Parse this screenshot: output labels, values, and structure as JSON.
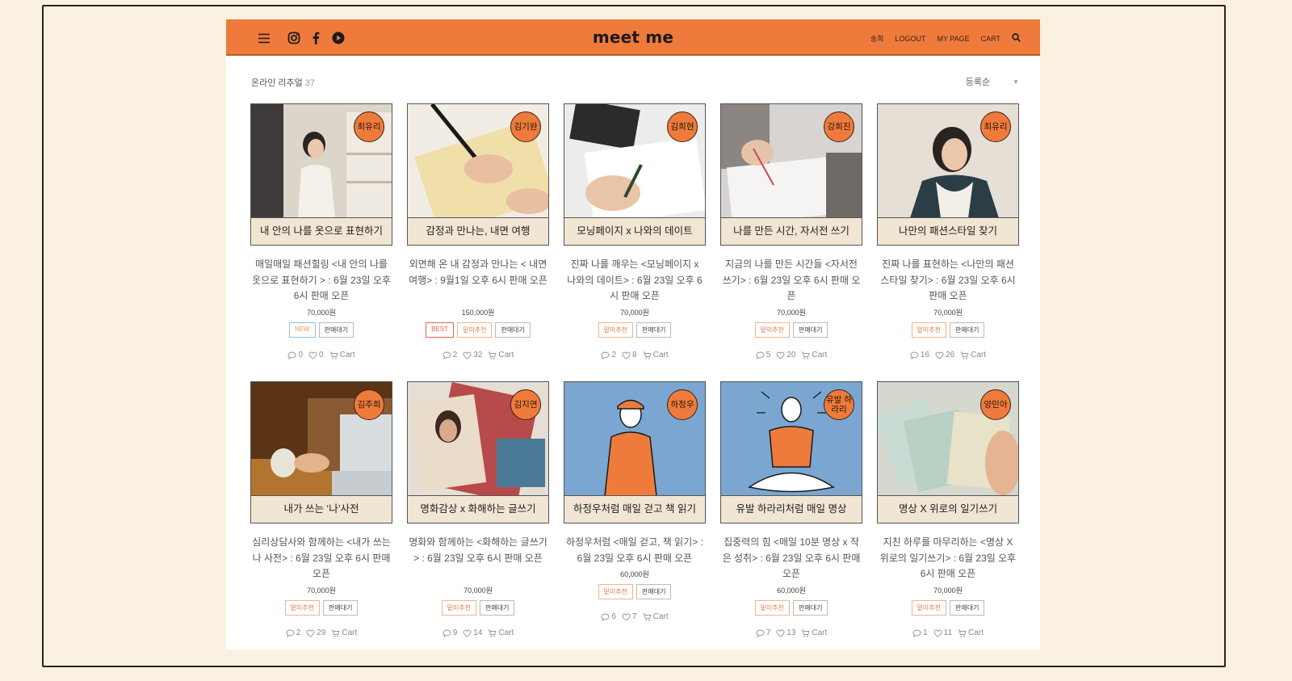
{
  "header": {
    "brand": "meet me",
    "nav": [
      "송희",
      "LOGOUT",
      "MY PAGE",
      "CART"
    ],
    "icons": [
      "menu-icon",
      "instagram-icon",
      "facebook-icon",
      "youtube-icon",
      "search-icon"
    ],
    "accent": "#ee7b3c"
  },
  "toolbar": {
    "category": "온라인 리추얼",
    "count": "37",
    "sort": "등록순"
  },
  "products": [
    {
      "host": "최유리",
      "caption": "내 안의 나를 옷으로 표현하기",
      "title": "매일매일 패션힐링 <내 안의 나를 옷으로 표현하기 > : 6월 23일 오후 6시 판매 오픈",
      "price": "70,000원",
      "tags": [
        {
          "t": "NEW",
          "k": "new"
        },
        {
          "t": "판매대기",
          "k": ""
        }
      ],
      "comments": "0",
      "likes": "0",
      "cart": "Cart",
      "photo": "#d9d3c8"
    },
    {
      "host": "김기완",
      "caption": "감정과 만나는, 내면 여행",
      "title": "외면해 온 내 감정과 만나는 < 내면 여행> : 9월1일 오후 6시 판매 오픈",
      "price": "150,000원",
      "tags": [
        {
          "t": "BEST",
          "k": "best"
        },
        {
          "t": "밑미추천",
          "k": "rec"
        },
        {
          "t": "판매대기",
          "k": ""
        }
      ],
      "comments": "2",
      "likes": "32",
      "cart": "Cart",
      "photo": "#e6dac0"
    },
    {
      "host": "김희현",
      "caption": "모닝페이지 x 나와의 데이트",
      "title": "진짜 나를 깨우는 <모닝페이지 x 나와의 데이트> : 6월 23일 오후 6시 판매 오픈",
      "price": "70,000원",
      "tags": [
        {
          "t": "밑미추천",
          "k": "rec"
        },
        {
          "t": "판매대기",
          "k": ""
        }
      ],
      "comments": "2",
      "likes": "8",
      "cart": "Cart",
      "photo": "#e9e7e2"
    },
    {
      "host": "강희진",
      "caption": "나를 만든 시간, 자서전 쓰기",
      "title": "지금의 나를 만든 시간들 <자서전 쓰기> : 6월 23일 오후 6시 판매 오픈",
      "price": "70,000원",
      "tags": [
        {
          "t": "밑미추천",
          "k": "rec"
        },
        {
          "t": "판매대기",
          "k": ""
        }
      ],
      "comments": "5",
      "likes": "20",
      "cart": "Cart",
      "photo": "#d8d4d0"
    },
    {
      "host": "최유리",
      "caption": "나만의 패션스타일 찾기",
      "title": "진짜 나를 표현하는 <나만의 패션스타일 찾기> : 6월 23일 오후 6시 판매 오픈",
      "price": "70,000원",
      "tags": [
        {
          "t": "밑미추천",
          "k": "rec"
        },
        {
          "t": "판매대기",
          "k": ""
        }
      ],
      "comments": "16",
      "likes": "26",
      "cart": "Cart",
      "photo": "#e2dcd2"
    },
    {
      "host": "김주희",
      "caption": "내가 쓰는 ‘나’사전",
      "title": "심리상담사와 함께하는 <내가 쓰는 나 사전> : 6월 23일 오후 6시 판매 오픈",
      "price": "70,000원",
      "tags": [
        {
          "t": "밑미추천",
          "k": "rec"
        },
        {
          "t": "판매대기",
          "k": ""
        }
      ],
      "comments": "2",
      "likes": "29",
      "cart": "Cart",
      "photo": "#7a4a22"
    },
    {
      "host": "김지연",
      "caption": "명화감상 x 화해하는 글쓰기",
      "title": "명화와 함께하는 <화해하는 글쓰기> : 6월 23일 오후 6시 판매 오픈",
      "price": "70,000원",
      "tags": [
        {
          "t": "밑미추천",
          "k": "rec"
        },
        {
          "t": "판매대기",
          "k": ""
        }
      ],
      "comments": "9",
      "likes": "14",
      "cart": "Cart",
      "photo": "#c9b6a2"
    },
    {
      "host": "하정우",
      "caption": "하정우처럼 매일 걷고 책 읽기",
      "title": "하정우처럼 <매일 걷고, 책 읽기> : 6월 23일 오후 6시 판매 오픈",
      "price": "60,000원",
      "tags": [
        {
          "t": "밑미추천",
          "k": "rec"
        },
        {
          "t": "판매대기",
          "k": ""
        }
      ],
      "comments": "6",
      "likes": "7",
      "cart": "Cart",
      "photo": "#7ca6d0"
    },
    {
      "host": "유발 하라리",
      "caption": "유발 하라리처럼 매일 명상",
      "title": "집중력의 힘 <매일 10분 명상 x 작은 성취> : 6월 23일 오후 6시 판매 오픈",
      "price": "60,000원",
      "tags": [
        {
          "t": "밑미추천",
          "k": "rec"
        },
        {
          "t": "판매대기",
          "k": ""
        }
      ],
      "comments": "7",
      "likes": "13",
      "cart": "Cart",
      "photo": "#7ca6d0"
    },
    {
      "host": "양민아",
      "caption": "명상 X 위로의 일기쓰기",
      "title": "지친 하루를 마무리하는 <명상 X 위로의 일기쓰기> : 6월 23일 오후 6시 판매 오픈",
      "price": "70,000원",
      "tags": [
        {
          "t": "밑미추천",
          "k": "rec"
        },
        {
          "t": "판매대기",
          "k": ""
        }
      ],
      "comments": "1",
      "likes": "11",
      "cart": "Cart",
      "photo": "#cfd6c6"
    }
  ]
}
